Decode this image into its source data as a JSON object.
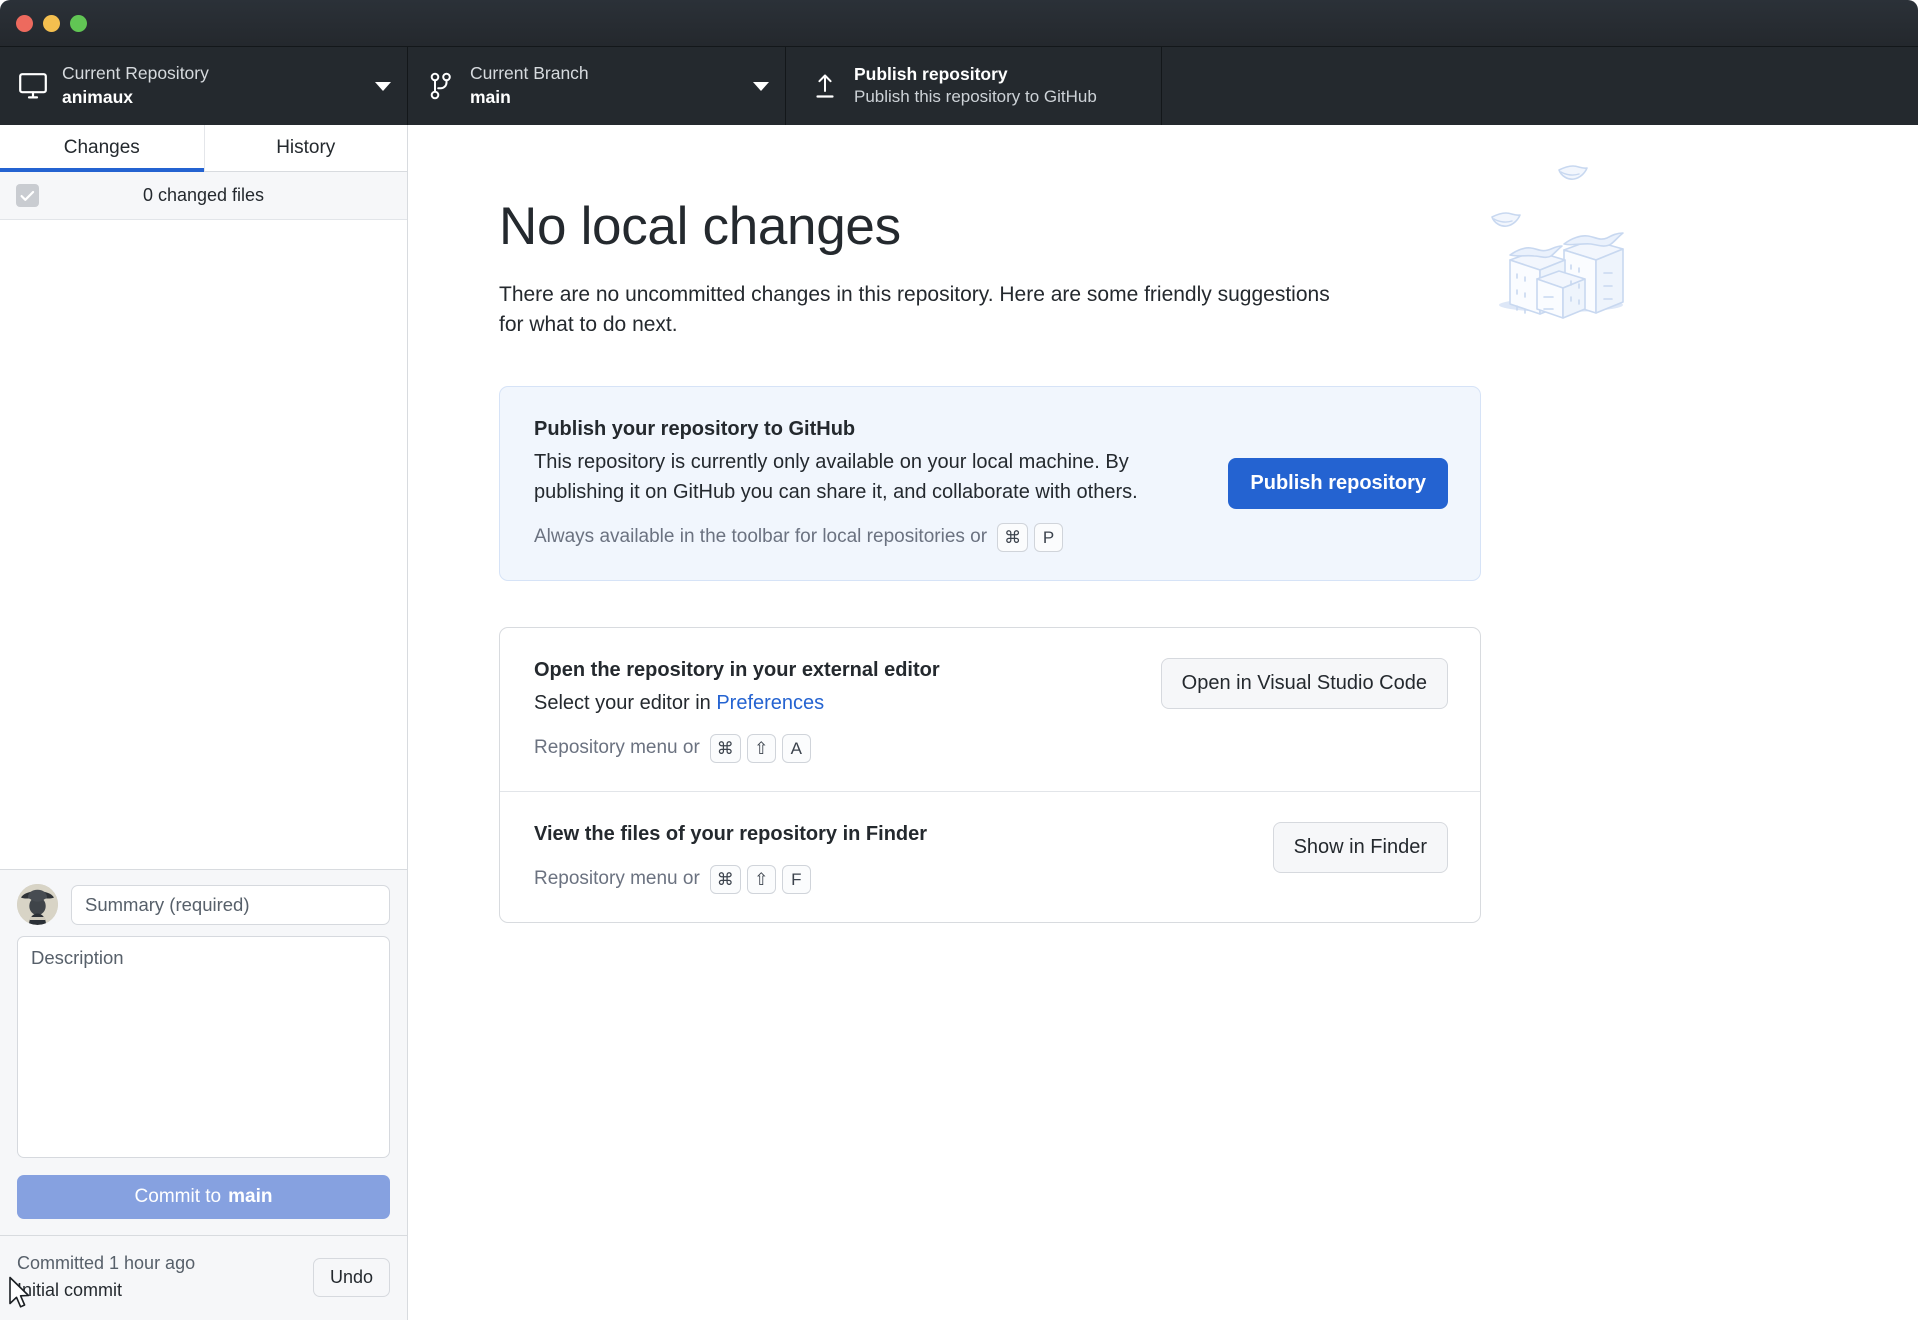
{
  "window": {
    "traffic_lights": [
      "close",
      "minimize",
      "maximize"
    ],
    "colors": {
      "close": "#ed6a5e",
      "minimize": "#f4bf4f",
      "maximize": "#61c554",
      "toolbar_bg": "#24292e",
      "accent_blue": "#2463d1",
      "commit_button": "#86a1e0",
      "tab_underline": "#2463d1",
      "card_blue_bg": "#f1f6fd"
    }
  },
  "toolbar": {
    "repository": {
      "icon": "desktop-icon",
      "label": "Current Repository",
      "value": "animaux",
      "caret": "chevron-down-icon"
    },
    "branch": {
      "icon": "branch-icon",
      "label": "Current Branch",
      "value": "main",
      "caret": "chevron-down-icon"
    },
    "publish": {
      "icon": "upload-icon",
      "label": "Publish repository",
      "value": "Publish this repository to GitHub"
    }
  },
  "sidebar": {
    "tabs": [
      {
        "label": "Changes",
        "active": true
      },
      {
        "label": "History",
        "active": false
      }
    ],
    "files_header": {
      "checkbox_state": "checked-disabled",
      "label": "0 changed files"
    },
    "commit_form": {
      "avatar": "user-avatar",
      "summary_placeholder": "Summary (required)",
      "summary_value": "",
      "description_placeholder": "Description",
      "description_value": "",
      "commit_button_prefix": "Commit to ",
      "commit_button_branch": "main"
    },
    "undo_bar": {
      "committed_when": "Committed 1 hour ago",
      "commit_message": "Initial commit",
      "undo_label": "Undo"
    }
  },
  "main": {
    "illustration": "stacked-boxes-illustration",
    "title": "No local changes",
    "lede": "There are no uncommitted changes in this repository. Here are some friendly suggestions for what to do next.",
    "cards": [
      {
        "id": "publish-card",
        "style": "blue",
        "title": "Publish your repository to GitHub",
        "description": "This repository is currently only available on your local machine. By publishing it on GitHub you can share it, and collaborate with others.",
        "hint_text": "Always available in the toolbar for local repositories or",
        "hint_keys": [
          "⌘",
          "P"
        ],
        "button": {
          "label": "Publish repository",
          "style": "primary"
        }
      },
      {
        "id": "external-editor-card",
        "style": "plain",
        "title": "Open the repository in your external editor",
        "description_prefix": "Select your editor in ",
        "description_link": "Preferences",
        "hint_text": "Repository menu or",
        "hint_keys": [
          "⌘",
          "⇧",
          "A"
        ],
        "button": {
          "label": "Open in Visual Studio Code",
          "style": "secondary"
        }
      },
      {
        "id": "finder-card",
        "style": "plain",
        "title": "View the files of your repository in Finder",
        "hint_text": "Repository menu or",
        "hint_keys": [
          "⌘",
          "⇧",
          "F"
        ],
        "button": {
          "label": "Show in Finder",
          "style": "secondary"
        }
      }
    ]
  }
}
